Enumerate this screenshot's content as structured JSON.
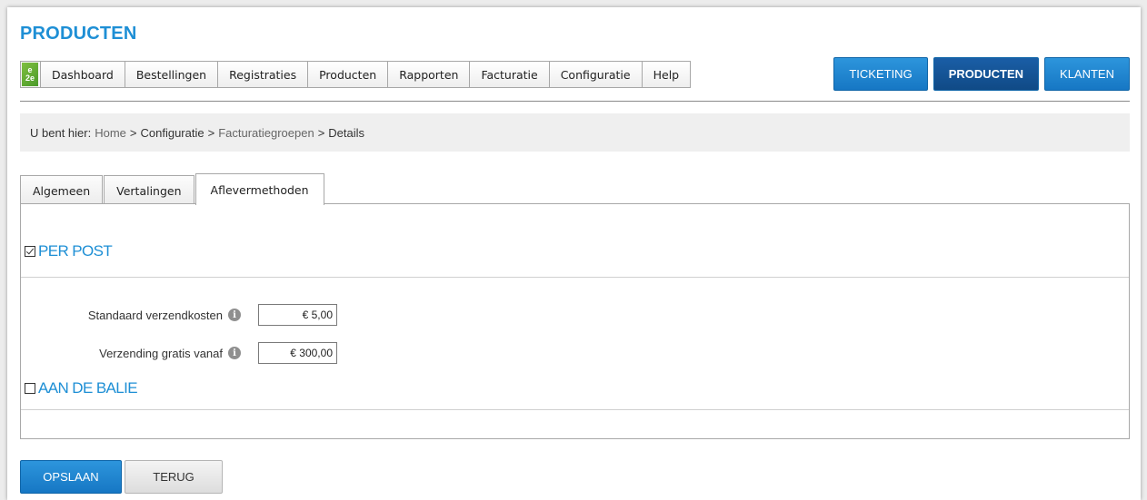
{
  "header": {
    "title": "PRODUCTEN",
    "logo_text": "e2e"
  },
  "menu": {
    "items": [
      {
        "label": "Dashboard"
      },
      {
        "label": "Bestellingen"
      },
      {
        "label": "Registraties"
      },
      {
        "label": "Producten"
      },
      {
        "label": "Rapporten"
      },
      {
        "label": "Facturatie"
      },
      {
        "label": "Configuratie"
      },
      {
        "label": "Help"
      }
    ]
  },
  "top_buttons": {
    "ticketing": "TICKETING",
    "producten": "PRODUCTEN",
    "klanten": "KLANTEN",
    "active": "PRODUCTEN"
  },
  "breadcrumb": {
    "prefix": "U bent hier:",
    "items": [
      "Home",
      "Configuratie",
      "Facturatiegroepen",
      "Details"
    ],
    "separator": ">"
  },
  "tabs": {
    "items": [
      {
        "label": "Algemeen"
      },
      {
        "label": "Vertalingen"
      },
      {
        "label": "Aflevermethoden"
      }
    ],
    "active": "Aflevermethoden"
  },
  "delivery": {
    "per_post": {
      "label": "PER POST",
      "checked": true,
      "fields": {
        "standard_costs_label": "Standaard verzendkosten",
        "standard_costs_value": "€ 5,00",
        "free_from_label": "Verzending gratis vanaf",
        "free_from_value": "€ 300,00"
      }
    },
    "aan_de_balie": {
      "label": "AAN DE BALIE",
      "checked": false
    }
  },
  "actions": {
    "save": "OPSLAAN",
    "back": "TERUG"
  },
  "colors": {
    "accent": "#1e8fd5",
    "button_blue": "#1677c4",
    "button_active": "#104a86"
  }
}
